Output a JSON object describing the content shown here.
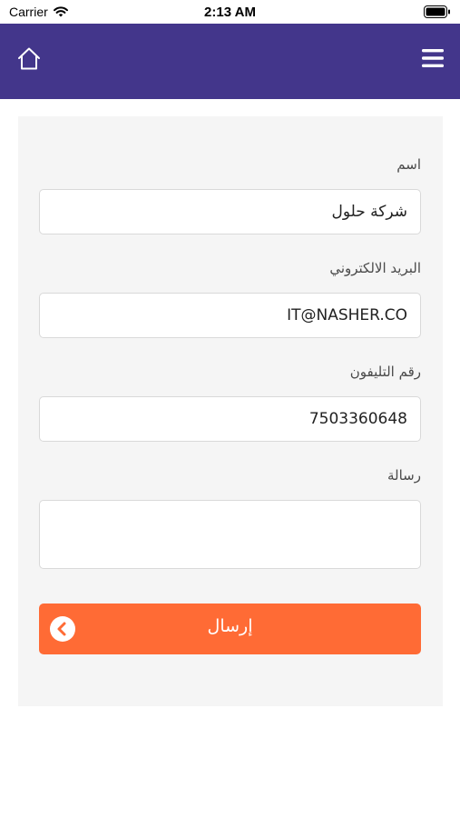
{
  "status_bar": {
    "carrier": "Carrier",
    "time": "2:13 AM"
  },
  "nav_bar": {
    "background": "#43368b",
    "left_icon": "home-icon",
    "right_icon": "hamburger-menu-icon"
  },
  "form": {
    "name_label": "اسم",
    "name_value": "شركة حلول",
    "email_label": "البريد الالكتروني",
    "email_value": "IT@NASHER.CO",
    "phone_label": "رقم التليفون",
    "phone_value": "7503360648",
    "message_label": "رسالة",
    "message_value": "",
    "submit_label": "إرسال",
    "submit_color": "#ff6b35",
    "submit_icon": "chevron-left-circle-icon"
  }
}
